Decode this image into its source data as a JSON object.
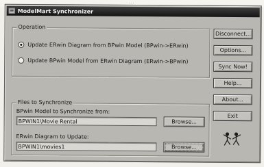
{
  "background": {
    "top_text": "..."
  },
  "window": {
    "title": "ModelMart Synchronizer"
  },
  "operation": {
    "label": "Operation",
    "options": [
      {
        "label": "Update ERwin Diagram from BPwin Model (BPwin->ERwin)",
        "selected": true
      },
      {
        "label": "Update BPwin Model from ERwin Diagram (ERwin->BPwin)",
        "selected": false
      }
    ]
  },
  "files": {
    "label": "Files to Synchronize",
    "bpwin_label": "BPwin Model to Synchronize from:",
    "bpwin_value": "BPWIN1\\Movie Rental",
    "erwin_label": "ERwin Diagram to Update:",
    "erwin_value": "BPWIN1\\movies1",
    "browse_label": "Browse..."
  },
  "buttons": {
    "disconnect": "Disconnect...",
    "options": "Options...",
    "sync_now": "Sync Now!",
    "help": "Help...",
    "about": "About...",
    "exit": "Exit"
  },
  "colors": {
    "window": "#b9b7b1",
    "titlebar": "#1e1e1e",
    "text": "#1a1a1a"
  },
  "icons": {
    "title": "app-window-icon",
    "logo": "dancing-figures-logo-icon"
  }
}
